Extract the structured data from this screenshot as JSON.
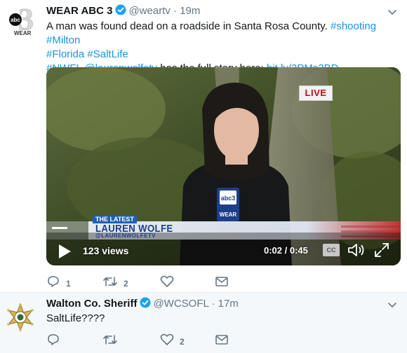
{
  "colors": {
    "link": "#1b95e0",
    "thread": "#a3d5f5",
    "muted": "#657786"
  },
  "tweet1": {
    "display_name": "WEAR ABC 3",
    "handle": "@weartv",
    "separator": "·",
    "time": "19m",
    "avatar_label": "WEAR",
    "avatar_digit": "3",
    "text_plain_1": "A man was found dead on a roadside in Santa Rosa County. ",
    "hashtag_shooting": "#shooting",
    "hashtag_milton": "#Milton",
    "hashtag_florida": "#Florida",
    "hashtag_saltlife": "#SaltLife",
    "hashtag_nwfl": "#NWFL",
    "mention_reporter": "@laurenwolfetv",
    "text_plain_2": " has the full story here: ",
    "story_link": "bit.ly/2PMs3BD",
    "video": {
      "live_badge": "LIVE",
      "lower_third_tag": "THE LATEST",
      "lower_third_name": "LAUREN WOLFE",
      "lower_third_handle": "@LAURENWOLFETV",
      "mic_flag_label": "WEAR",
      "views": "123 views",
      "time": "0:02 / 0:45",
      "cc_label": "CC",
      "progress_fraction": 0.044
    },
    "actions": {
      "reply_count": "1",
      "retweet_count": "2",
      "like_count": ""
    }
  },
  "tweet2": {
    "display_name": "Walton Co. Sheriff",
    "handle": "@WCSOFL",
    "separator": "·",
    "time": "17m",
    "text": "SaltLife????",
    "actions": {
      "reply_count": "",
      "retweet_count": "",
      "like_count": "2"
    }
  }
}
